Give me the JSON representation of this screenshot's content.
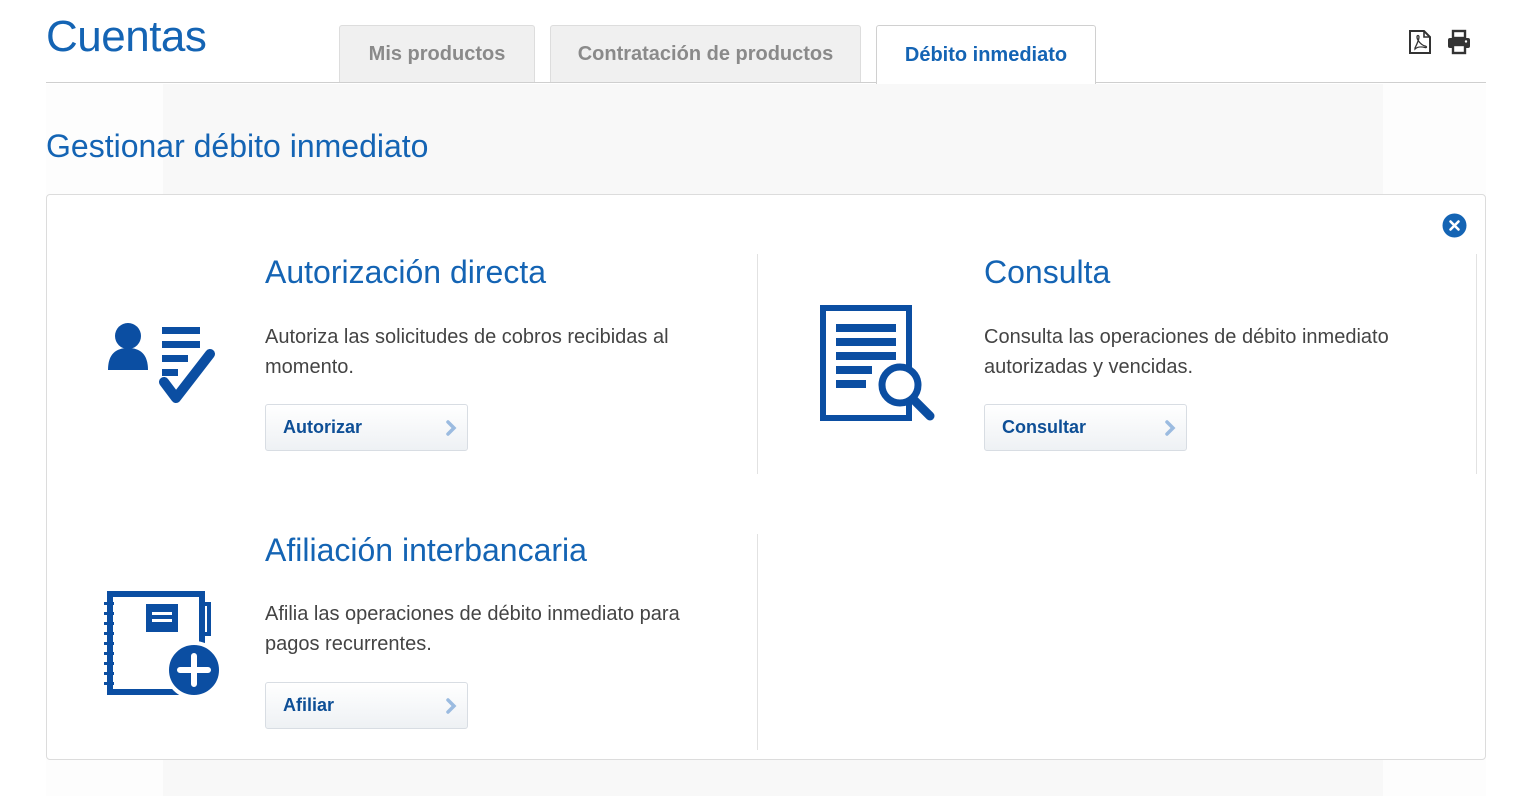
{
  "header": {
    "title": "Cuentas",
    "tabs": [
      {
        "label": "Mis productos",
        "active": false
      },
      {
        "label": "Contratación de productos",
        "active": false
      },
      {
        "label": "Débito inmediato",
        "active": true
      }
    ],
    "tools": [
      "pdf-icon",
      "print-icon"
    ]
  },
  "page": {
    "subtitle": "Gestionar débito inmediato"
  },
  "cards": {
    "autorizacion": {
      "title": "Autorización directa",
      "desc_line1": "Autoriza las solicitudes de cobros recibidas al",
      "desc_line2": "momento.",
      "button": "Autorizar",
      "icon": "user-checklist-icon"
    },
    "consulta": {
      "title": "Consulta",
      "desc_line1": "Consulta las operaciones de débito inmediato",
      "desc_line2": "autorizadas y vencidas.",
      "button": "Consultar",
      "icon": "document-search-icon"
    },
    "afiliacion": {
      "title": "Afiliación interbancaria",
      "desc_line1": "Afilia las operaciones de débito inmediato para",
      "desc_line2": "pagos recurrentes.",
      "button": "Afiliar",
      "icon": "notebook-add-icon"
    }
  },
  "colors": {
    "brand_blue": "#1464b4",
    "icon_blue": "#0b4ea2",
    "button_text": "#0e4f96",
    "chevron": "#9bbbe0"
  }
}
